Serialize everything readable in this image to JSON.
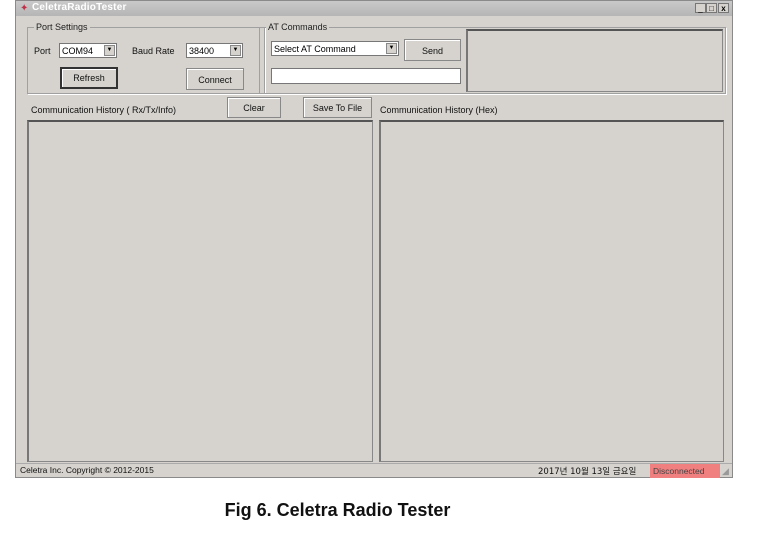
{
  "window": {
    "title": "CeletraRadioTester",
    "minimize": "_",
    "maximize": "□",
    "close": "x"
  },
  "port_settings": {
    "legend": "Port Settings",
    "port_label": "Port",
    "port_value": "COM94",
    "baud_label": "Baud Rate",
    "baud_value": "38400",
    "refresh": "Refresh",
    "connect": "Connect"
  },
  "at_commands": {
    "legend": "AT Commands",
    "select_value": "Select AT Command",
    "send": "Send",
    "input_value": ""
  },
  "history": {
    "left_label": "Communication History ( Rx/Tx/Info)",
    "clear": "Clear",
    "save": "Save To File",
    "right_label": "Communication History (Hex)"
  },
  "status": {
    "copyright": "Celetra Inc. Copyright ©  2012-2015",
    "date": "2017년 10월 13일 금요일",
    "connection": "Disconnected",
    "connection_color": "#f08080"
  },
  "caption": "Fig 6. Celetra Radio Tester"
}
